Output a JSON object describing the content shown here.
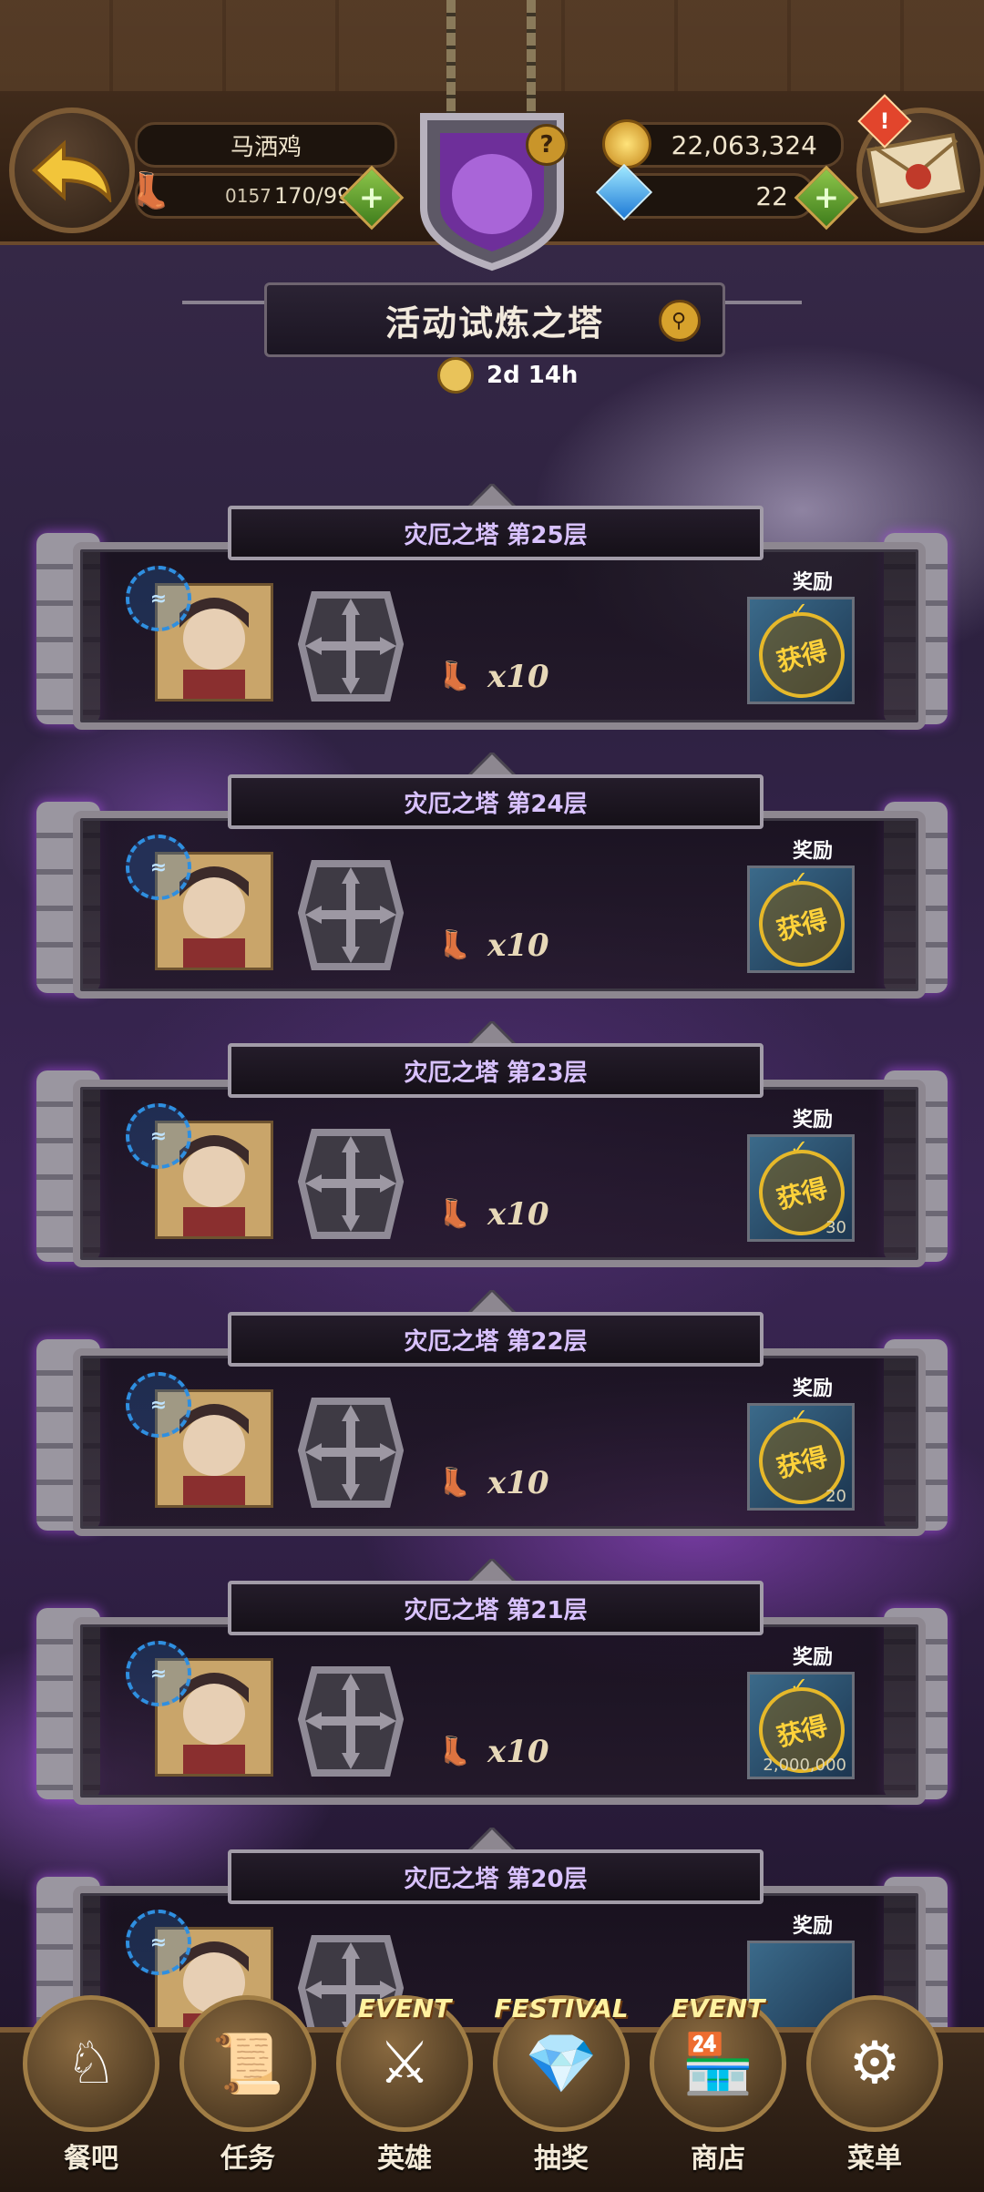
{
  "header": {
    "player_name": "马洒鸡",
    "stamina_timer": "0157",
    "stamina": "170/99",
    "gold": "22,063,324",
    "gems": "22",
    "help_icon": "question-icon",
    "mail_alert": "!"
  },
  "event": {
    "title": "活动试炼之塔",
    "time_left": "2d 14h"
  },
  "floors": [
    {
      "name": "灾厄之塔 第25层",
      "ticket": "x10",
      "reward_label": "奖励",
      "claimed": "获得",
      "amount": ""
    },
    {
      "name": "灾厄之塔 第24层",
      "ticket": "x10",
      "reward_label": "奖励",
      "claimed": "获得",
      "amount": ""
    },
    {
      "name": "灾厄之塔 第23层",
      "ticket": "x10",
      "reward_label": "奖励",
      "claimed": "获得",
      "amount": "30"
    },
    {
      "name": "灾厄之塔 第22层",
      "ticket": "x10",
      "reward_label": "奖励",
      "claimed": "获得",
      "amount": "20"
    },
    {
      "name": "灾厄之塔 第21层",
      "ticket": "x10",
      "reward_label": "奖励",
      "claimed": "获得",
      "amount": "2,000,000"
    },
    {
      "name": "灾厄之塔 第20层",
      "ticket": "",
      "reward_label": "奖励",
      "claimed": "",
      "amount": ""
    }
  ],
  "nav": [
    {
      "label": "餐吧",
      "tag": ""
    },
    {
      "label": "任务",
      "tag": ""
    },
    {
      "label": "英雄",
      "tag": "EVENT"
    },
    {
      "label": "抽奖",
      "tag": "FESTIVAL"
    },
    {
      "label": "商店",
      "tag": "EVENT"
    },
    {
      "label": "菜单",
      "tag": ""
    }
  ],
  "colors": {
    "accent_purple": "#b56cff",
    "gold": "#ffd23a",
    "plus_green": "#6bb33a"
  }
}
